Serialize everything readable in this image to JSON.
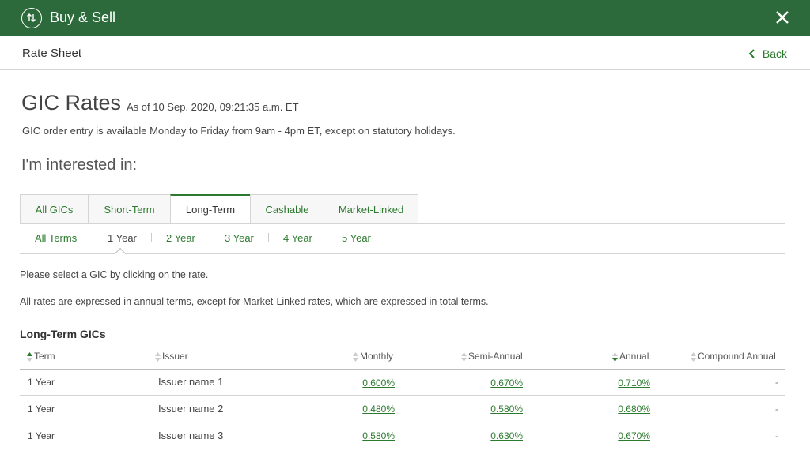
{
  "header": {
    "title": "Buy & Sell",
    "close_label": "×"
  },
  "subheader": {
    "title": "Rate Sheet",
    "back_label": "Back"
  },
  "page": {
    "title": "GIC Rates",
    "as_of": "As of 10 Sep. 2020, 09:21:35 a.m. ET",
    "order_note": "GIC order entry is available Monday to Friday from 9am - 4pm ET, except on statutory holidays.",
    "interested": "I'm interested in:"
  },
  "tabs": [
    {
      "label": "All GICs",
      "active": false
    },
    {
      "label": "Short-Term",
      "active": false
    },
    {
      "label": "Long-Term",
      "active": true
    },
    {
      "label": "Cashable",
      "active": false
    },
    {
      "label": "Market-Linked",
      "active": false
    }
  ],
  "terms": [
    {
      "label": "All Terms",
      "active": false
    },
    {
      "label": "1 Year",
      "active": true
    },
    {
      "label": "2 Year",
      "active": false
    },
    {
      "label": "3 Year",
      "active": false
    },
    {
      "label": "4 Year",
      "active": false
    },
    {
      "label": "5 Year",
      "active": false
    }
  ],
  "notes": {
    "select": "Please select a GIC by clicking on the rate.",
    "rates": "All rates are expressed in annual terms, except for Market-Linked rates, which are expressed in total terms."
  },
  "table": {
    "title": "Long-Term GICs",
    "columns": [
      "Term",
      "Issuer",
      "Monthly",
      "Semi-Annual",
      "Annual",
      "Compound Annual"
    ],
    "rows": [
      {
        "term": "1 Year",
        "issuer": "Issuer name 1",
        "monthly": "0.600%",
        "semi_annual": "0.670%",
        "annual": "0.710%",
        "compound": "-"
      },
      {
        "term": "1 Year",
        "issuer": "Issuer name 2",
        "monthly": "0.480%",
        "semi_annual": "0.580%",
        "annual": "0.680%",
        "compound": "-"
      },
      {
        "term": "1 Year",
        "issuer": "Issuer name 3",
        "monthly": "0.580%",
        "semi_annual": "0.630%",
        "annual": "0.670%",
        "compound": "-"
      }
    ]
  },
  "colors": {
    "brand": "#2c6a3b",
    "link": "#2c7a2e"
  }
}
